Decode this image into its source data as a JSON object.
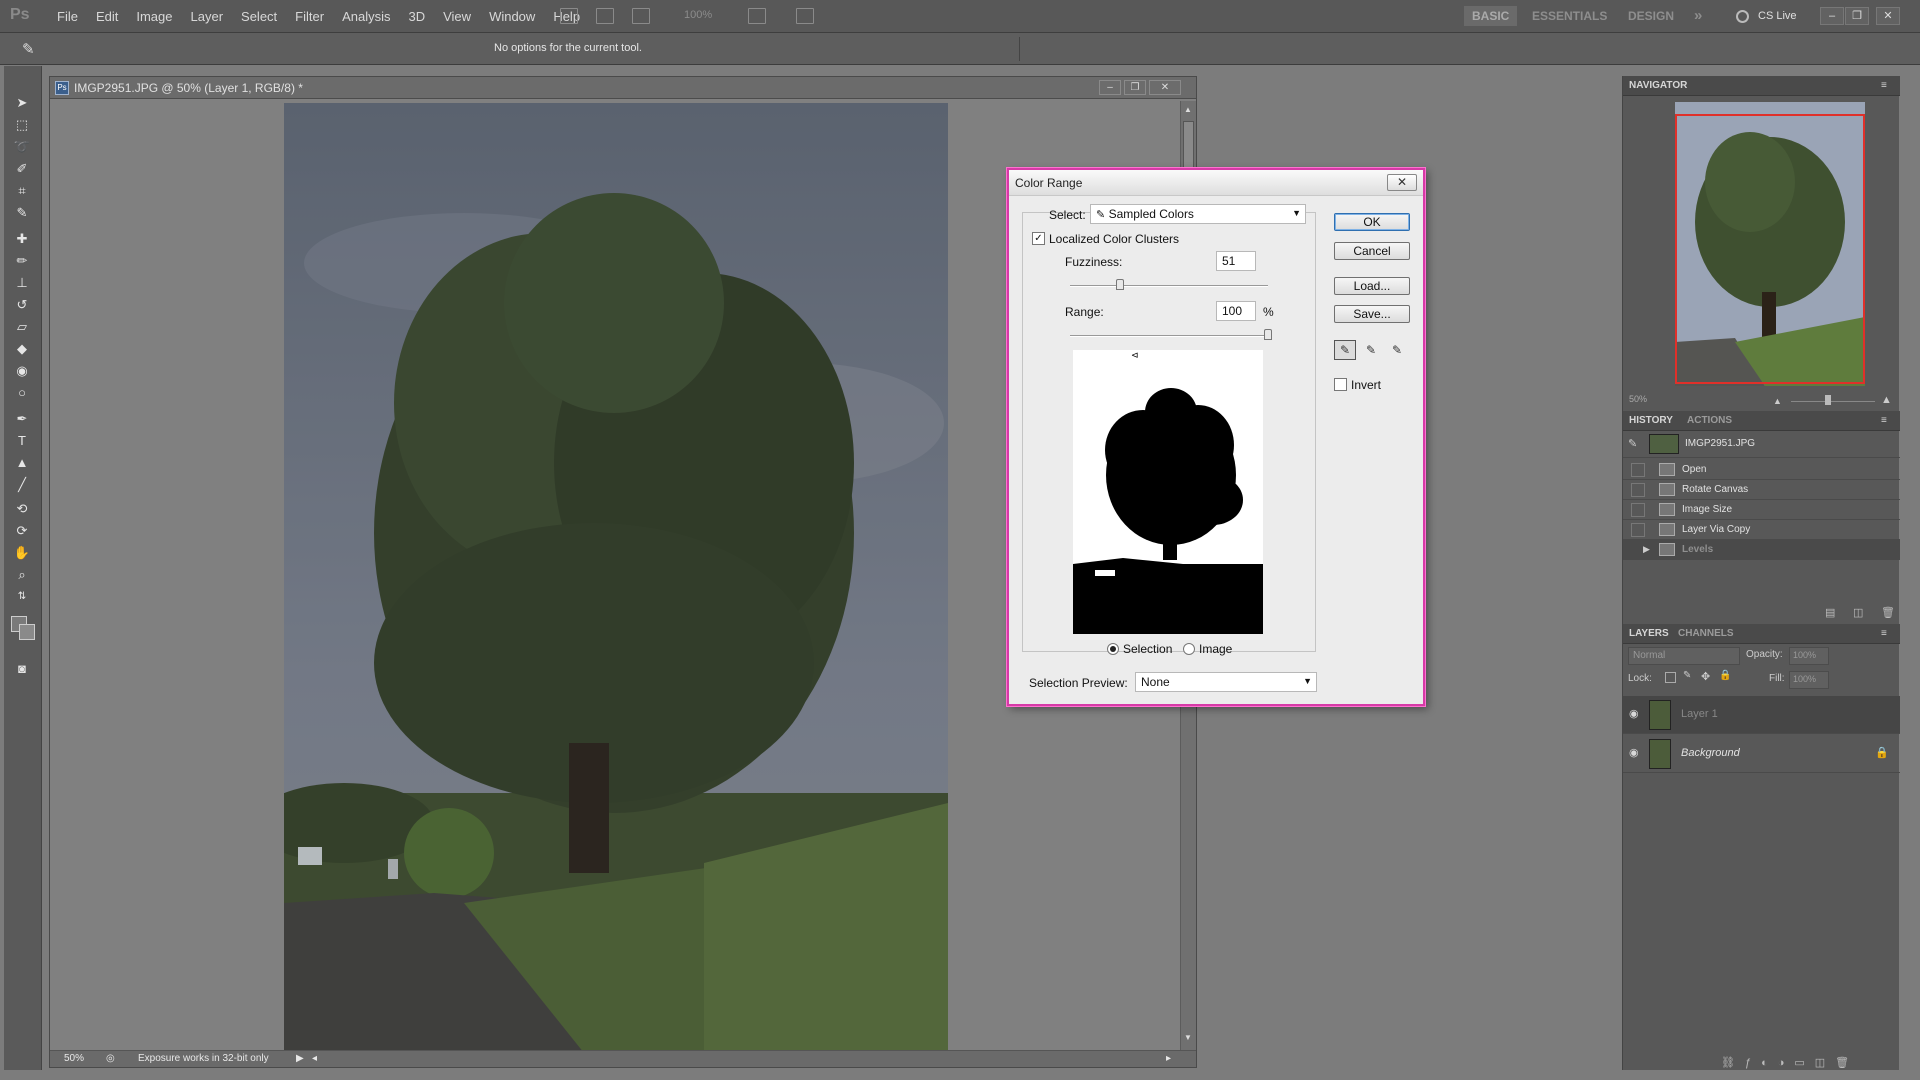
{
  "app": {
    "logo": "Ps"
  },
  "menu": [
    "File",
    "Edit",
    "Image",
    "Layer",
    "Select",
    "Filter",
    "Analysis",
    "3D",
    "View",
    "Window",
    "Help"
  ],
  "toolbar_zoom": "100%",
  "workspaces": {
    "basic": "BASIC",
    "essentials": "ESSENTIALS",
    "design": "DESIGN",
    "more": "»"
  },
  "cslive": "CS Live",
  "options_bar": {
    "message": "No options for the current tool."
  },
  "document": {
    "title": "IMGP2951.JPG @ 50% (Layer 1, RGB/8) *",
    "zoom": "50%",
    "status": "Exposure works in 32-bit only"
  },
  "dialog": {
    "title": "Color Range",
    "select_label": "Select:",
    "select_value": "Sampled Colors",
    "localized_label": "Localized Color Clusters",
    "localized_checked": true,
    "fuzziness_label": "Fuzziness:",
    "fuzziness_value": "51",
    "fuzziness_fraction": 0.25,
    "range_label": "Range:",
    "range_value": "100",
    "range_unit": "%",
    "range_fraction": 1.0,
    "selection_radio": "Selection",
    "image_radio": "Image",
    "preview_label": "Selection Preview:",
    "preview_value": "None",
    "buttons": {
      "ok": "OK",
      "cancel": "Cancel",
      "load": "Load...",
      "save": "Save..."
    },
    "invert_label": "Invert"
  },
  "navigator": {
    "tab": "NAVIGATOR",
    "zoom": "50%"
  },
  "history": {
    "tabs": [
      "HISTORY",
      "ACTIONS"
    ],
    "snapshot": "IMGP2951.JPG",
    "items": [
      "Open",
      "Rotate Canvas",
      "Image Size",
      "Layer Via Copy",
      "Levels"
    ]
  },
  "layers": {
    "tabs": [
      "LAYERS",
      "CHANNELS"
    ],
    "blend_mode": "Normal",
    "opacity_label": "Opacity:",
    "opacity_value": "100%",
    "lock_label": "Lock:",
    "fill_label": "Fill:",
    "fill_value": "100%",
    "items": [
      "Layer 1",
      "Background"
    ]
  }
}
